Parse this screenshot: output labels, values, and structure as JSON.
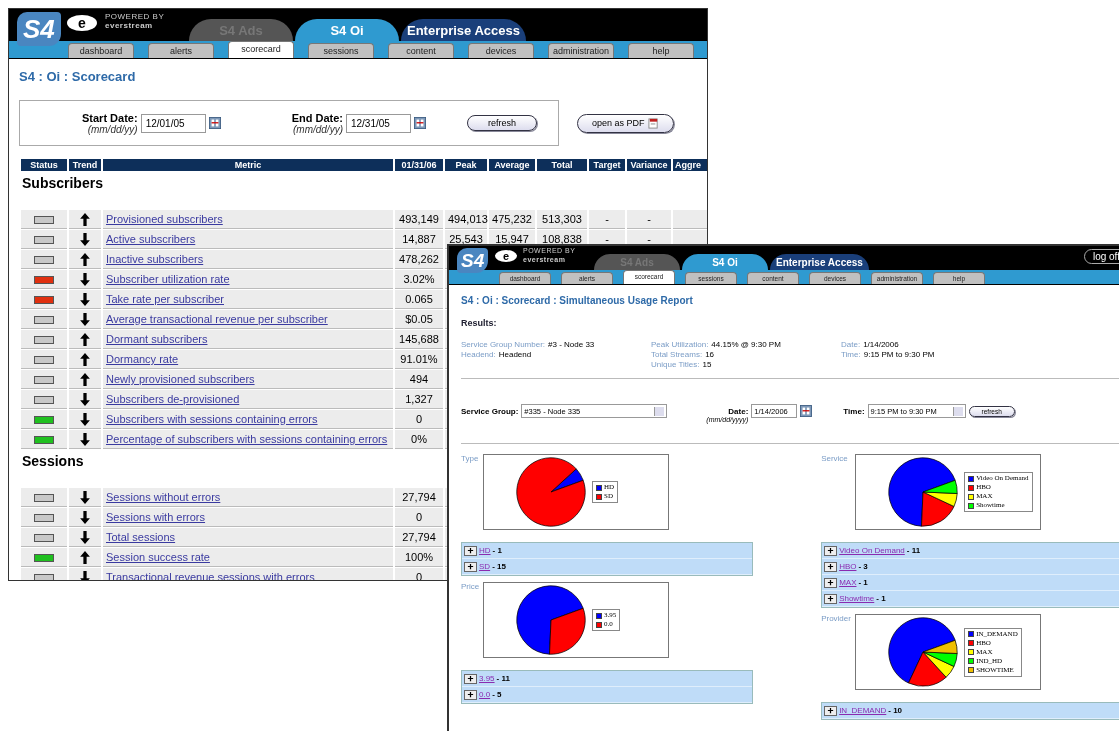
{
  "back_window": {
    "header": {
      "logo": "S4",
      "e_logo": "e",
      "powered_by": "POWERED BY",
      "company": "everstream",
      "app_tabs": [
        {
          "label": "S4 Ads",
          "selected": false,
          "disabled": true
        },
        {
          "label": "S4 Oi",
          "selected": true,
          "disabled": false
        },
        {
          "label": "Enterprise Access",
          "selected": false,
          "disabled": false
        }
      ],
      "nav_tabs": [
        {
          "label": "dashboard",
          "selected": false
        },
        {
          "label": "alerts",
          "selected": false
        },
        {
          "label": "scorecard",
          "selected": true
        },
        {
          "label": "sessions",
          "selected": false
        },
        {
          "label": "content",
          "selected": false
        },
        {
          "label": "devices",
          "selected": false
        },
        {
          "label": "administration",
          "selected": false
        },
        {
          "label": "help",
          "selected": false
        }
      ]
    },
    "page_title": "S4 : Oi : Scorecard",
    "filters": {
      "start_label": "Start Date:",
      "start_hint": "(mm/dd/yy)",
      "start_value": "12/01/05",
      "end_label": "End Date:",
      "end_hint": "(mm/dd/yy)",
      "end_value": "12/31/05",
      "refresh": "refresh"
    },
    "pdf_button": "open as PDF",
    "table": {
      "columns": [
        "Status",
        "Trend",
        "Metric",
        "01/31/06",
        "Peak",
        "Average",
        "Total",
        "Target",
        "Variance",
        "Aggre"
      ],
      "sections": [
        {
          "title": "Subscribers",
          "rows": [
            {
              "color": "#c8c8c8",
              "rising": true,
              "metric": "Provisioned subscribers",
              "values": [
                "493,149",
                "494,013",
                "475,232",
                "513,303",
                "-",
                "-"
              ]
            },
            {
              "color": "#c8c8c8",
              "rising": false,
              "metric": "Active subscribers",
              "values": [
                "14,887",
                "25,543",
                "15,947",
                "108,838",
                "-",
                "-"
              ]
            },
            {
              "color": "#c8c8c8",
              "rising": true,
              "metric": "Inactive subscribers",
              "values": [
                "478,262"
              ]
            },
            {
              "color": "#e03010",
              "rising": false,
              "metric": "Subscriber utilization rate",
              "values": [
                "3.02%"
              ]
            },
            {
              "color": "#e03010",
              "rising": false,
              "metric": "Take rate per subscriber",
              "values": [
                "0.065"
              ]
            },
            {
              "color": "#c8c8c8",
              "rising": false,
              "metric": "Average transactional revenue per subscriber",
              "values": [
                "$0.05"
              ]
            },
            {
              "color": "#c8c8c8",
              "rising": true,
              "metric": "Dormant subscribers",
              "values": [
                "145,688"
              ]
            },
            {
              "color": "#c8c8c8",
              "rising": true,
              "metric": "Dormancy rate",
              "values": [
                "91.01%"
              ]
            },
            {
              "color": "#c8c8c8",
              "rising": true,
              "metric": "Newly provisioned subscribers",
              "values": [
                "494"
              ]
            },
            {
              "color": "#c8c8c8",
              "rising": false,
              "metric": "Subscribers de-provisioned",
              "values": [
                "1,327"
              ]
            },
            {
              "color": "#20c020",
              "rising": false,
              "metric": "Subscribers with sessions containing errors",
              "values": [
                "0"
              ]
            },
            {
              "color": "#20c020",
              "rising": false,
              "metric": "Percentage of subscribers with sessions containing errors",
              "values": [
                "0%"
              ]
            }
          ]
        },
        {
          "title": "Sessions",
          "rows": [
            {
              "color": "#c8c8c8",
              "rising": false,
              "metric": "Sessions without errors",
              "values": [
                "27,794"
              ]
            },
            {
              "color": "#c8c8c8",
              "rising": false,
              "metric": "Sessions with errors",
              "values": [
                "0"
              ]
            },
            {
              "color": "#c8c8c8",
              "rising": false,
              "metric": "Total sessions",
              "values": [
                "27,794"
              ]
            },
            {
              "color": "#20c020",
              "rising": true,
              "metric": "Session success rate",
              "values": [
                "100%"
              ]
            },
            {
              "color": "#c8c8c8",
              "rising": false,
              "metric": "Transactional revenue sessions with errors",
              "values": [
                "0"
              ]
            }
          ]
        }
      ]
    }
  },
  "front_window": {
    "header": {
      "logo": "S4",
      "e_logo": "e",
      "powered_by": "POWERED BY",
      "company": "everstream",
      "log_off": "log off",
      "app_tabs": [
        {
          "label": "S4 Ads",
          "selected": false,
          "disabled": true
        },
        {
          "label": "S4 Oi",
          "selected": true,
          "disabled": false
        },
        {
          "label": "Enterprise Access",
          "selected": false,
          "disabled": false
        }
      ],
      "nav_tabs": [
        {
          "label": "dashboard",
          "selected": false
        },
        {
          "label": "alerts",
          "selected": false
        },
        {
          "label": "scorecard",
          "selected": true
        },
        {
          "label": "sessions",
          "selected": false
        },
        {
          "label": "content",
          "selected": false
        },
        {
          "label": "devices",
          "selected": false
        },
        {
          "label": "administration",
          "selected": false
        },
        {
          "label": "help",
          "selected": false
        }
      ]
    },
    "page_title": "S4 : Oi : Scorecard : Simultaneous Usage Report",
    "results_heading": "Results:",
    "results": [
      [
        {
          "label": "Service Group Number:",
          "value": "#3 - Node 33"
        },
        {
          "label": "Headend:",
          "value": "Headend"
        }
      ],
      [
        {
          "label": "Peak Utilization:",
          "value": "44.15% @ 9:30 PM"
        },
        {
          "label": "Total Streams:",
          "value": "16"
        },
        {
          "label": "Unique Titles:",
          "value": "15"
        }
      ],
      [
        {
          "label": "Date:",
          "value": "1/14/2006"
        },
        {
          "label": "Time:",
          "value": "9:15 PM to 9:30 PM"
        }
      ]
    ],
    "form": {
      "group_label": "Service Group:",
      "group_value": "#335 - Node 335",
      "date_label": "Date:",
      "date_hint": "(mm/dd/yyyy)",
      "date_value": "1/14/2006",
      "time_label": "Time:",
      "time_value": "9:15 PM to 9:30 PM",
      "refresh": "refresh"
    },
    "columns": [
      [
        {
          "title": "Type",
          "chart_data": {
            "type": "pie",
            "legend": "right",
            "categories": [
              "HD",
              "SD"
            ],
            "values": [
              6.25,
              93.75
            ],
            "colors": [
              "#0000ff",
              "#ff0000"
            ]
          },
          "items": [
            {
              "label": "HD",
              "count": "- 1"
            },
            {
              "label": "SD",
              "count": "- 15"
            }
          ]
        },
        {
          "title": "Price",
          "chart_data": {
            "type": "pie",
            "legend": "right",
            "categories": [
              "3.95",
              "0.0"
            ],
            "values": [
              68.75,
              31.25
            ],
            "colors": [
              "#0000ff",
              "#ff0000"
            ]
          },
          "items": [
            {
              "label": "3.95",
              "count": "- 11"
            },
            {
              "label": "0.0",
              "count": "- 5"
            }
          ]
        }
      ],
      [
        {
          "title": "Service",
          "chart_data": {
            "type": "pie",
            "legend": "right",
            "categories": [
              "Video On Demand",
              "HBO",
              "MAX",
              "Showtime"
            ],
            "values": [
              68.75,
              18.75,
              6.25,
              6.25
            ],
            "colors": [
              "#0000ff",
              "#ff0000",
              "#ffff00",
              "#00ff00"
            ]
          },
          "items": [
            {
              "label": "Video On Demand",
              "count": "- 11"
            },
            {
              "label": "HBO",
              "count": "- 3"
            },
            {
              "label": "MAX",
              "count": "- 1"
            },
            {
              "label": "Showtime",
              "count": "- 1"
            }
          ]
        },
        {
          "title": "Provider",
          "chart_data": {
            "type": "pie",
            "legend": "right",
            "categories": [
              "IN_DEMAND",
              "HBO",
              "MAX",
              "IND_HD",
              "SHOWTIME"
            ],
            "values": [
              62.5,
              18.75,
              6.25,
              6.25,
              6.25
            ],
            "colors": [
              "#0000ff",
              "#ff0000",
              "#ffff00",
              "#00ff00",
              "#f0c000"
            ]
          },
          "items": [
            {
              "label": "IN_DEMAND",
              "count": "- 10"
            }
          ]
        }
      ]
    ]
  }
}
